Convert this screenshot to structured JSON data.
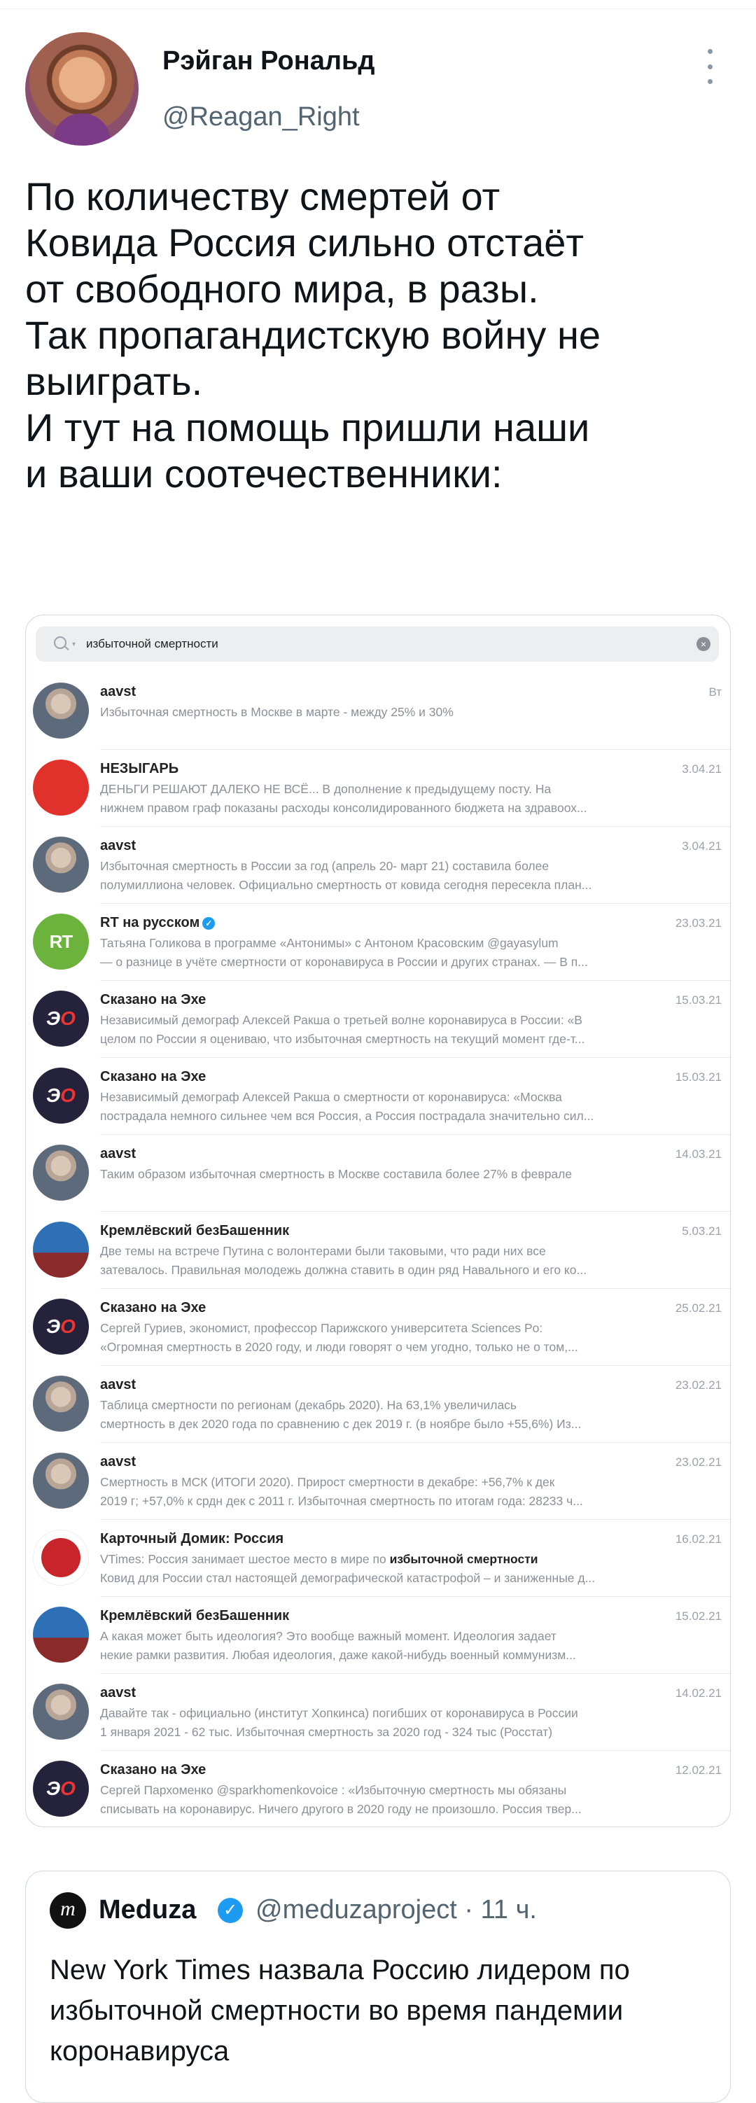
{
  "author": {
    "name": "Рэйган Рональд",
    "handle": "@Reagan_Right"
  },
  "tweet": {
    "lines": [
      "По количеству смертей от",
      "Ковида Россия сильно отстаёт",
      "от свободного мира, в разы.",
      "Так пропагандистскую войну не",
      "выиграть.",
      "И тут на помощь пришли наши",
      "и ваши соотечественники:"
    ]
  },
  "screenshot": {
    "search_query": "избыточной смертности",
    "results": [
      {
        "name": "aavst",
        "date": "Вт",
        "avatar": "aavst",
        "line1": "Избыточная смертность в Москве в марте - между 25% и 30%",
        "line2": ""
      },
      {
        "name": "НЕЗЫГАРЬ",
        "date": "3.04.21",
        "avatar": "nezygar",
        "line1": "ДЕНЬГИ РЕШАЮТ ДАЛЕКО НЕ ВСЁ... В дополнение к предыдущему посту. На",
        "line2": "нижнем правом граф показаны расходы консолидированного бюджета на здравоох..."
      },
      {
        "name": "aavst",
        "date": "3.04.21",
        "avatar": "aavst",
        "line1": "Избыточная смертность в России за год (апрель 20- март 21) составила более",
        "line2": "полумиллиона человек. Официально смертность от ковида сегодня пересекла план..."
      },
      {
        "name": "RT на русском",
        "date": "23.03.21",
        "avatar": "rt",
        "verified": true,
        "line1": "Татьяна Голикова в программе «Антонимы» с Антоном Красовским @gayasylum",
        "line2": "— о разнице в учёте смертности от коронавируса в России и других странах. — В п..."
      },
      {
        "name": "Сказано на Эхе",
        "date": "15.03.21",
        "avatar": "echo",
        "line1": "Независимый демограф Алексей Ракша о третьей волне коронавируса в России: «В",
        "line2": "целом по России я оцениваю, что избыточная смертность на текущий момент где-т..."
      },
      {
        "name": "Сказано на Эхе",
        "date": "15.03.21",
        "avatar": "echo",
        "line1": "Независимый демограф Алексей Ракша о смертности от коронавируса: «Москва",
        "line2": "пострадала немного сильнее чем вся Россия, а Россия пострадала значительно сил..."
      },
      {
        "name": "aavst",
        "date": "14.03.21",
        "avatar": "aavst",
        "line1": "Таким образом избыточная смертность в Москве составила более 27% в феврале",
        "line2": ""
      },
      {
        "name": "Кремлёвский безБашенник",
        "date": "5.03.21",
        "avatar": "kreml",
        "line1": "Две темы на встрече Путина с волонтерами были таковыми, что ради них все",
        "line2": "затевалось. Правильная молодежь должна ставить в один ряд Навального и его ко..."
      },
      {
        "name": "Сказано на Эхе",
        "date": "25.02.21",
        "avatar": "echo",
        "line1": "Сергей Гуриев, экономист, профессор Парижского университета Sciences Po:",
        "line2": "«Огромная смертность в 2020 году, и люди говорят о чем угодно, только не о том,..."
      },
      {
        "name": "aavst",
        "date": "23.02.21",
        "avatar": "aavst",
        "line1": "Таблица смертности по регионам (декабрь 2020). На 63,1% увеличилась",
        "line2": "смертность в дек 2020 года по сравнению с дек 2019 г. (в ноябре было +55,6%) Из..."
      },
      {
        "name": "aavst",
        "date": "23.02.21",
        "avatar": "aavst",
        "line1": "Смертность в МСК (ИТОГИ 2020). Прирост смертности в декабре: +56,7% к дек",
        "line2": "2019 г; +57,0% к срдн дек с 2011 г. Избыточная смертность по итогам года: 28233 ч..."
      },
      {
        "name": "Карточный Домик: Россия",
        "date": "16.02.21",
        "avatar": "kart",
        "line1_prefix": "VTimes: Россия занимает шестое место в мире по ",
        "line1_highlight": "избыточной смертности",
        "line2": "Ковид для России стал настоящей демографической катастрофой – и заниженные д..."
      },
      {
        "name": "Кремлёвский безБашенник",
        "date": "15.02.21",
        "avatar": "kreml",
        "line1": "А какая может быть идеология? Это вообще важный момент. Идеология задает",
        "line2": "некие рамки развития. Любая идеология, даже какой-нибудь военный коммунизм..."
      },
      {
        "name": "aavst",
        "date": "14.02.21",
        "avatar": "aavst",
        "line1": "Давайте так - официально (институт Хопкинса) погибших от коронавируса в России",
        "line2": "1 января 2021 - 62 тыс. Избыточная смертность за 2020 год - 324 тыс (Росстат)"
      },
      {
        "name": "Сказано на Эхе",
        "date": "12.02.21",
        "avatar": "echo",
        "line1": "Сергей Пархоменко @sparkhomenkovoice : «Избыточную смертность мы обязаны",
        "line2": "списывать на коронавирус. Ничего другого в 2020 году не произошло. Россия твер..."
      }
    ]
  },
  "quote": {
    "logo": "m",
    "name": "Meduza",
    "meta": "@meduzaproject · 11 ч.",
    "text": "New York Times назвала Россию лидером по избыточной смертности во время пандемии коронавируса"
  }
}
